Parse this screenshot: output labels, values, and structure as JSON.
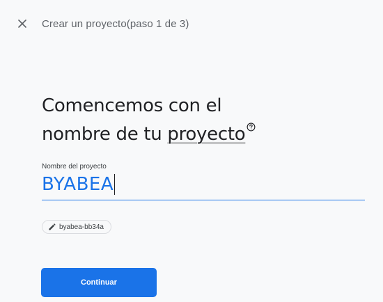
{
  "header": {
    "close_icon": "close-icon",
    "title": "Crear un proyecto(paso 1 de 3)"
  },
  "main": {
    "heading_line1": "Comencemos con el",
    "heading_line2_prefix": "nombre de tu ",
    "heading_line2_link": "proyecto",
    "help_icon": "help-circle-icon"
  },
  "project_name_field": {
    "label": "Nombre del proyecto",
    "value": "BYABEA"
  },
  "project_id_chip": {
    "icon": "pencil-icon",
    "label": "byabea-bb34a"
  },
  "actions": {
    "continue_label": "Continuar"
  },
  "colors": {
    "accent": "#1a73e8",
    "background": "#f8f9fa",
    "text": "#202124",
    "muted": "#5f6368"
  }
}
